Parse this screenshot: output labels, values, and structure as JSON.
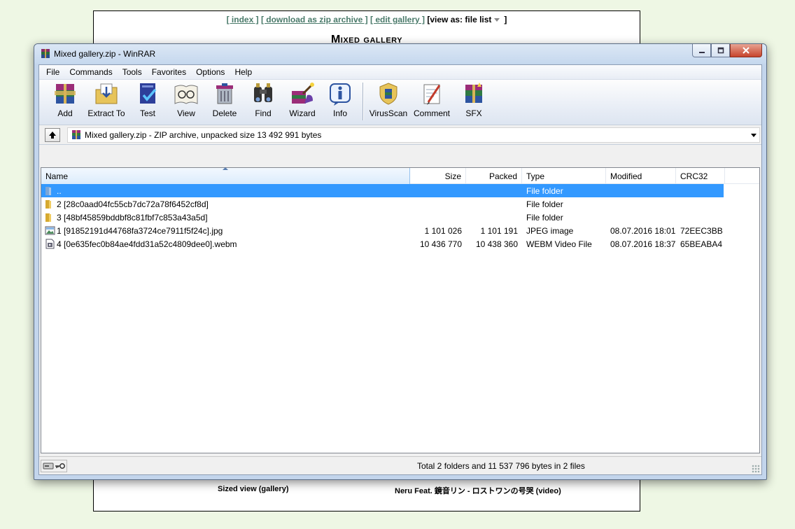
{
  "background_page": {
    "nav": {
      "index": "[ index ]",
      "download": "[ download as zip archive ]",
      "edit": "[ edit gallery ]",
      "view_as_label": "[view as:",
      "view_as_value": "file list",
      "close_bracket": "]"
    },
    "title": "Mixed gallery",
    "captions": [
      "Sized view (gallery)",
      "Neru Feat. 鏡音リン - ロストワンの号哭 (video)"
    ]
  },
  "window": {
    "title": "Mixed gallery.zip - WinRAR",
    "caption_buttons": {
      "minimize": "minimize-icon",
      "maximize": "maximize-icon",
      "close": "close-icon"
    }
  },
  "menu": [
    "File",
    "Commands",
    "Tools",
    "Favorites",
    "Options",
    "Help"
  ],
  "toolbar": [
    {
      "label": "Add",
      "icon": "add-icon"
    },
    {
      "label": "Extract To",
      "icon": "extract-icon"
    },
    {
      "label": "Test",
      "icon": "test-icon"
    },
    {
      "label": "View",
      "icon": "view-icon"
    },
    {
      "label": "Delete",
      "icon": "delete-icon"
    },
    {
      "label": "Find",
      "icon": "find-icon"
    },
    {
      "label": "Wizard",
      "icon": "wizard-icon"
    },
    {
      "label": "Info",
      "icon": "info-icon"
    },
    {
      "label": "VirusScan",
      "icon": "virusscan-icon"
    },
    {
      "label": "Comment",
      "icon": "comment-icon"
    },
    {
      "label": "SFX",
      "icon": "sfx-icon"
    }
  ],
  "address": {
    "text": "Mixed gallery.zip - ZIP archive, unpacked size 13 492 991 bytes"
  },
  "columns": [
    "Name",
    "Size",
    "Packed",
    "Type",
    "Modified",
    "CRC32"
  ],
  "rows": [
    {
      "name": "..",
      "size": "",
      "packed": "",
      "type": "File folder",
      "modified": "",
      "crc": "",
      "icon": "folder-up-icon",
      "selected": true
    },
    {
      "name": "2 [28c0aad04fc55cb7dc72a78f6452cf8d]",
      "size": "",
      "packed": "",
      "type": "File folder",
      "modified": "",
      "crc": "",
      "icon": "folder-icon",
      "selected": false
    },
    {
      "name": "3 [48bf45859bddbf8c81fbf7c853a43a5d]",
      "size": "",
      "packed": "",
      "type": "File folder",
      "modified": "",
      "crc": "",
      "icon": "folder-icon",
      "selected": false
    },
    {
      "name": "1 [91852191d44768fa3724ce7911f5f24c].jpg",
      "size": "1 101 026",
      "packed": "1 101 191",
      "type": "JPEG image",
      "modified": "08.07.2016 18:01",
      "crc": "72EEC3BB",
      "icon": "image-file-icon",
      "selected": false
    },
    {
      "name": "4 [0e635fec0b84ae4fdd31a52c4809dee0].webm",
      "size": "10 436 770",
      "packed": "10 438 360",
      "type": "WEBM Video File",
      "modified": "08.07.2016 18:37",
      "crc": "65BEABA4",
      "icon": "video-file-icon",
      "selected": false
    }
  ],
  "status": {
    "text": "Total 2 folders and 11 537 796 bytes in 2 files",
    "icons": [
      "drive-icon",
      "key-icon"
    ]
  },
  "colors": {
    "selection": "#3399ff",
    "background": "#eef7e4"
  }
}
